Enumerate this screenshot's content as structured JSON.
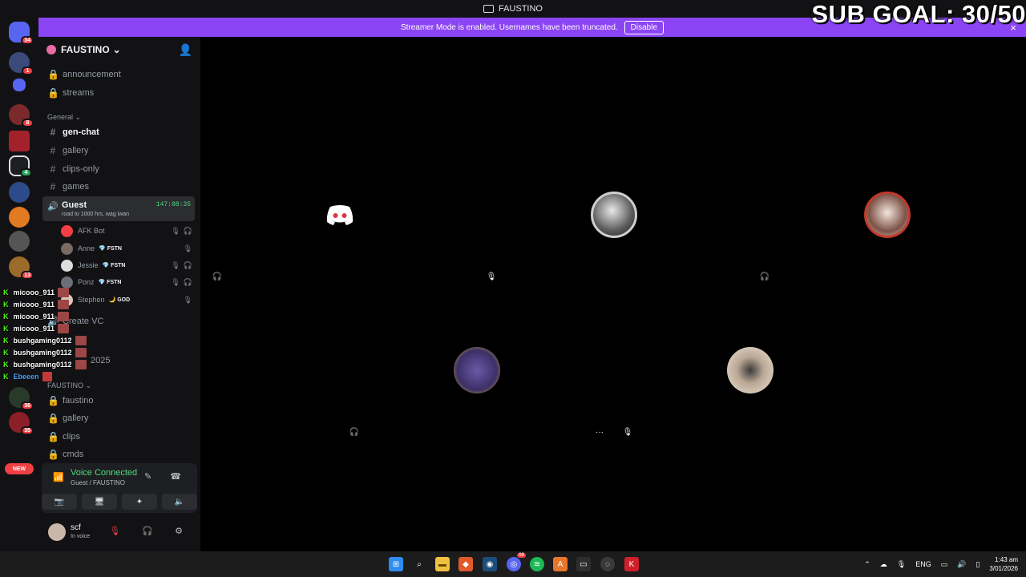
{
  "window": {
    "title": "FAUSTINO"
  },
  "overlay": {
    "sub_goal": "SUB GOAL: 30/50"
  },
  "banner": {
    "text": "Streamer Mode is enabled. Usernames have been truncated.",
    "disable_label": "Disable",
    "close_icon": "×"
  },
  "guild_badges": {
    "home": "34",
    "g1": "1",
    "g3": "8",
    "g6": "4",
    "g10": "13",
    "g11": "36",
    "g12": "35",
    "new": "NEW"
  },
  "server": {
    "name": "FAUSTINO",
    "chevron": "⌄",
    "add_icon": "👤"
  },
  "channels_top": [
    {
      "name": "announcement",
      "icon": "🔒"
    },
    {
      "name": "streams",
      "icon": "🔒"
    }
  ],
  "category_general": "General ⌄",
  "channels_general": [
    {
      "name": "gen-chat",
      "icon": "#"
    },
    {
      "name": "gallery",
      "icon": "#"
    },
    {
      "name": "clips-only",
      "icon": "#"
    },
    {
      "name": "games",
      "icon": "#"
    }
  ],
  "voice_channel": {
    "name": "Guest",
    "status": "road to 1000 hrs, wag iwan",
    "timer": "147:08:35",
    "icon": "🔊"
  },
  "members": [
    {
      "name": "AFK Bot",
      "tag": "",
      "icons": "🎙🎧",
      "color": "#f23f43"
    },
    {
      "name": "Anne",
      "tag": "💎 FSTN",
      "icons": "🎙",
      "color": "#7a6a62"
    },
    {
      "name": "Jessie",
      "tag": "💎 FSTN",
      "icons": "🎙🎧",
      "color": "#dddddd"
    },
    {
      "name": "Ponz",
      "tag": "💎 FSTN",
      "icons": "🎙🎧",
      "color": "#6a6f78"
    },
    {
      "name": "Stephen",
      "tag": "🌙 GOD",
      "icons": "🎙",
      "color": "#d8c7b6"
    }
  ],
  "channels_mid": [
    {
      "name": "Create VC",
      "icon": "🔊"
    },
    {
      "name": "2025",
      "icon": ""
    }
  ],
  "category_faustino": "FAUSTINO ⌄",
  "channels_faustino": [
    {
      "name": "faustino",
      "icon": "🔒"
    },
    {
      "name": "gallery",
      "icon": "🔒"
    },
    {
      "name": "clips",
      "icon": "🔒"
    },
    {
      "name": "cmds",
      "icon": "🔒"
    }
  ],
  "voice_panel": {
    "title": "Voice Connected",
    "subtitle": "Guest / FAUSTINO",
    "signal_icon": "📶",
    "icons": "✎ ☎"
  },
  "voice_buttons": [
    {
      "label": "📷",
      "name": "camera-button"
    },
    {
      "label": "🖥",
      "name": "screen-share-button"
    },
    {
      "label": "✦",
      "name": "activities-button"
    },
    {
      "label": "🔈",
      "name": "soundboard-button"
    }
  ],
  "user": {
    "name": "scf",
    "status": "In voice",
    "mute_icon": "🎙",
    "icons": "🎧 ⚙"
  },
  "chat_overlay": [
    {
      "user": "micooo_911",
      "blue": false
    },
    {
      "user": "micooo_911",
      "blue": false
    },
    {
      "user": "micooo_911",
      "blue": false
    },
    {
      "user": "micooo_911",
      "blue": false
    },
    {
      "user": "bushgaming0112",
      "blue": false
    },
    {
      "user": "bushgaming0112",
      "blue": false
    },
    {
      "user": "bushgaming0112",
      "blue": false
    },
    {
      "user": "Ebeeen",
      "blue": true
    }
  ],
  "chat_kick_icon": "K",
  "tiles": [
    {
      "name": "afk-bot-tile",
      "bg": "#da3745",
      "avatar": "discord",
      "state": "🎧",
      "more": ""
    },
    {
      "name": "anne-tile",
      "bg": "#1e1e20",
      "avatar": "#8a8a8a",
      "state": "🎙",
      "more": ""
    },
    {
      "name": "jessie-tile",
      "bg": "#c5b6ad",
      "avatar": "#b25b4f",
      "state": "🎧",
      "more": ""
    },
    {
      "name": "ponz-tile",
      "bg": "#4a4d55",
      "avatar": "#5e4f8c",
      "state": "🎧",
      "more": "···"
    },
    {
      "name": "stephen-tile",
      "bg": "#d8c3a9",
      "avatar": "#a89481",
      "state": "🎙",
      "more": ""
    }
  ],
  "taskbar": {
    "apps": [
      {
        "name": "start-button",
        "color": "#2f8cf0",
        "glyph": "⊞"
      },
      {
        "name": "search-icon",
        "color": "#1c1c1c",
        "glyph": "⌕"
      },
      {
        "name": "file-explorer-icon",
        "color": "#f0c040",
        "glyph": "▬"
      },
      {
        "name": "brave-icon",
        "color": "#e05a2b",
        "glyph": "◆"
      },
      {
        "name": "steam-icon",
        "color": "#1b4d7a",
        "glyph": "◉"
      },
      {
        "name": "discord-taskbar-icon",
        "color": "#5865f2",
        "glyph": "◎"
      },
      {
        "name": "spotify-icon",
        "color": "#1db954",
        "glyph": "≋"
      },
      {
        "name": "app-a-icon",
        "color": "#e8762b",
        "glyph": "A"
      },
      {
        "name": "terminal-icon",
        "color": "#2e2e2e",
        "glyph": "▭"
      },
      {
        "name": "obs-icon",
        "color": "#3a3a3a",
        "glyph": "◌"
      },
      {
        "name": "kick-app-icon",
        "color": "#d01f2c",
        "glyph": "K"
      }
    ],
    "discord_badge": "99",
    "tray_icons": "⌃",
    "language": "ENG",
    "time": "1:43 am",
    "date": "3/01/2026"
  }
}
